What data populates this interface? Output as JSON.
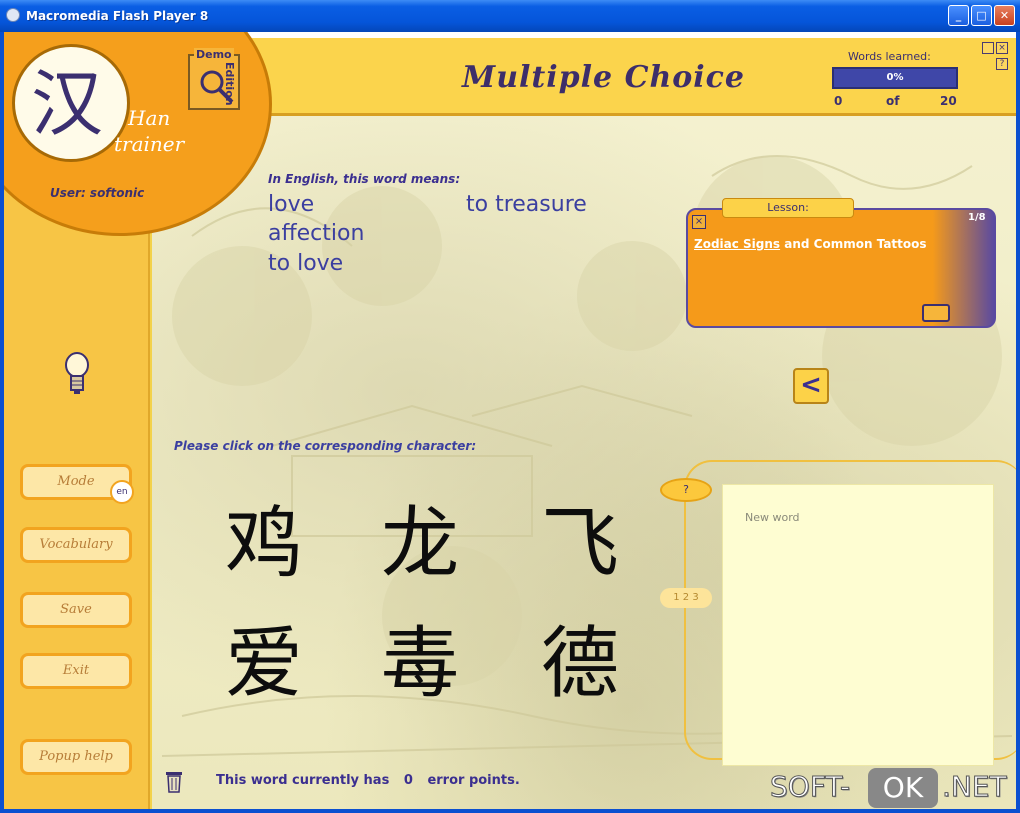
{
  "window": {
    "title": "Macromedia Flash Player 8",
    "minimize_glyph": "_",
    "maximize_glyph": "□",
    "close_glyph": "✕"
  },
  "header": {
    "title": "Multiple Choice"
  },
  "logo": {
    "character": "汉",
    "name_line1": "Han",
    "name_line2": "trainer",
    "demo": "Demo",
    "edition": "Edition",
    "user": "User: softonic"
  },
  "progress": {
    "label": "Words learned:",
    "percent_text": "0%",
    "fraction": 0,
    "learned": "0",
    "of": "of",
    "total": "20"
  },
  "question": {
    "prompt": "In English, this word means:",
    "meanings": [
      "love",
      "to treasure",
      "affection",
      "to love"
    ],
    "instruction": "Please click on the corresponding character:",
    "characters": [
      "鸡",
      "龙",
      "飞",
      "爱",
      "毒",
      "德"
    ]
  },
  "lesson": {
    "tab": "Lesson:",
    "count": "1/8",
    "title_link": "Zodiac Signs",
    "title_rest": " and Common Tattoos"
  },
  "panel": {
    "help": "?",
    "pager": "1 2 3",
    "new_word": "New word"
  },
  "menu": {
    "mode": "Mode",
    "lang": "en",
    "vocabulary": "Vocabulary",
    "save": "Save",
    "exit": "Exit",
    "popup_help": "Popup help"
  },
  "status": {
    "before": "This word currently has",
    "count": "0",
    "after": "error points."
  },
  "watermark": {
    "soft": "SOFT-",
    "ok": "OK",
    "net": ".NET"
  }
}
